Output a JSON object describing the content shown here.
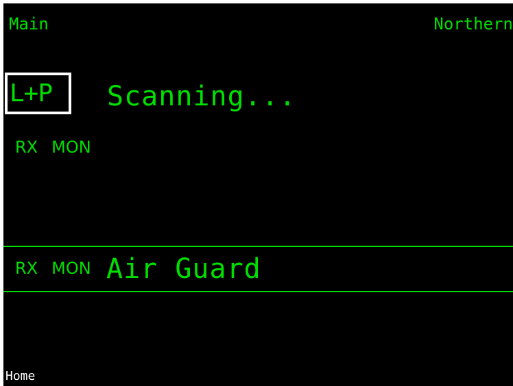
{
  "header": {
    "left_label": "Main",
    "right_label": "Northern"
  },
  "active": {
    "mode_label": "L+P",
    "status_text": "Scanning...",
    "rx_label": "RX",
    "mon_label": "MON"
  },
  "secondary": {
    "rx_label": "RX",
    "mon_label": "MON",
    "channel_name": "Air Guard"
  },
  "softkeys": {
    "home_label": "Home"
  },
  "colors": {
    "background": "#000000",
    "text": "#00e000",
    "highlight_border": "#ffffff",
    "softkey_text": "#ffffff",
    "bezel": "#ffffff"
  }
}
